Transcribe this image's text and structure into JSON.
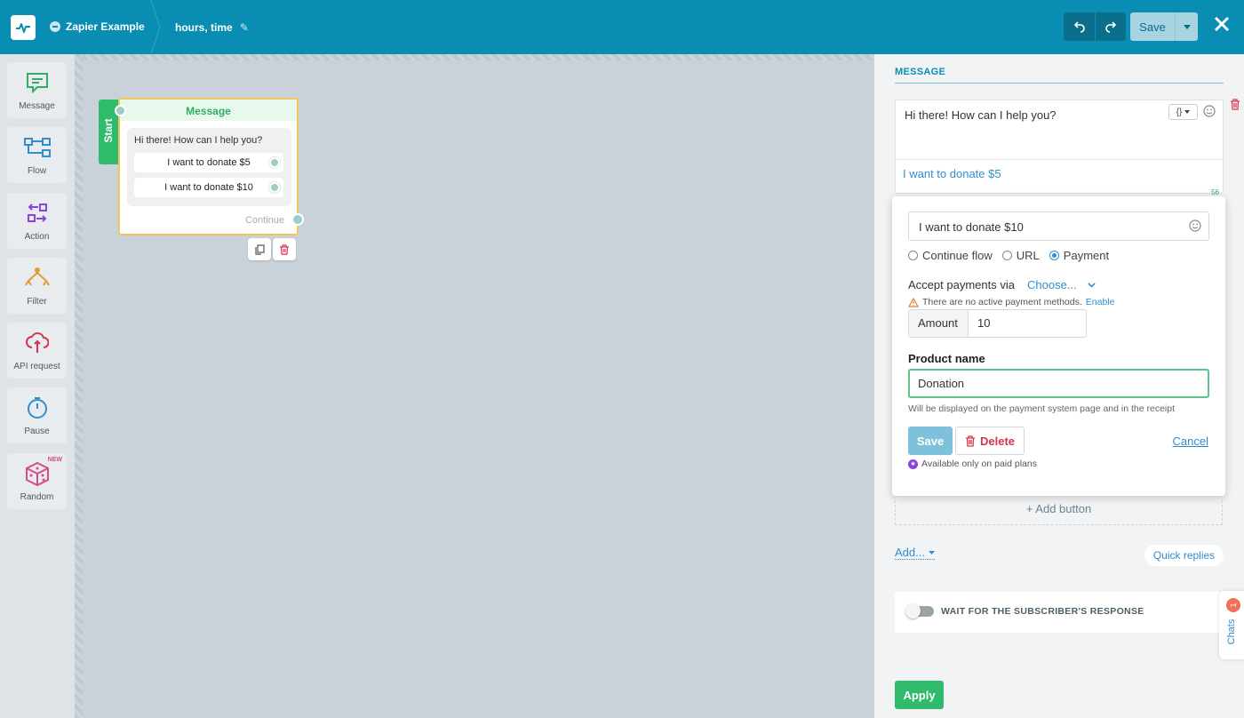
{
  "header": {
    "bot_name": "Zapier Example",
    "flow_name": "hours, time",
    "save_label": "Save"
  },
  "sidebar": {
    "items": [
      {
        "label": "Message",
        "icon": "message-icon",
        "color": "#2eae63"
      },
      {
        "label": "Flow",
        "icon": "flow-icon",
        "color": "#2f8fce"
      },
      {
        "label": "Action",
        "icon": "action-icon",
        "color": "#8b44d8"
      },
      {
        "label": "Filter",
        "icon": "filter-icon",
        "color": "#e39b2e"
      },
      {
        "label": "API request",
        "icon": "api-request-icon",
        "color": "#d6334d"
      },
      {
        "label": "Pause",
        "icon": "pause-icon",
        "color": "#2f8fce"
      },
      {
        "label": "Random",
        "icon": "random-icon",
        "color": "#d84a8a",
        "badge": "NEW"
      }
    ]
  },
  "canvas": {
    "start_label": "Start",
    "node": {
      "title": "Message",
      "text": "Hi there! How can I help you?",
      "buttons": [
        "I want to donate $5",
        "I want to donate $10"
      ],
      "continue_label": "Continue"
    }
  },
  "panel": {
    "section_label": "MESSAGE",
    "message_text": "Hi there! How can I help you?",
    "variable_button": "{}",
    "button1_label": "I want to donate $5",
    "char_count": "56",
    "popup": {
      "button_text": "I want to donate $10",
      "options": [
        "Continue flow",
        "URL",
        "Payment"
      ],
      "selected_option": "Payment",
      "accept_label": "Accept payments via",
      "choose_label": "Choose...",
      "warning_text": "There are no active payment methods.",
      "enable_link": "Enable",
      "amount_label": "Amount",
      "amount_value": "10",
      "product_label": "Product name",
      "product_value": "Donation",
      "product_hint": "Will be displayed on the payment system page and in the receipt",
      "save_label": "Save",
      "delete_label": "Delete",
      "cancel_label": "Cancel",
      "paid_note": "Available only on paid plans"
    },
    "add_button_label": "+ Add button",
    "add_label": "Add...",
    "quick_replies_label": "Quick replies",
    "wait_label": "WAIT FOR THE SUBSCRIBER'S RESPONSE",
    "wait_enabled": false,
    "chats_label": "Chats",
    "chats_count": "1",
    "apply_label": "Apply"
  },
  "colors": {
    "topbar": "#0a8db3",
    "accent_green": "#2eae63",
    "link_blue": "#2f8fce",
    "danger": "#d6334d"
  }
}
